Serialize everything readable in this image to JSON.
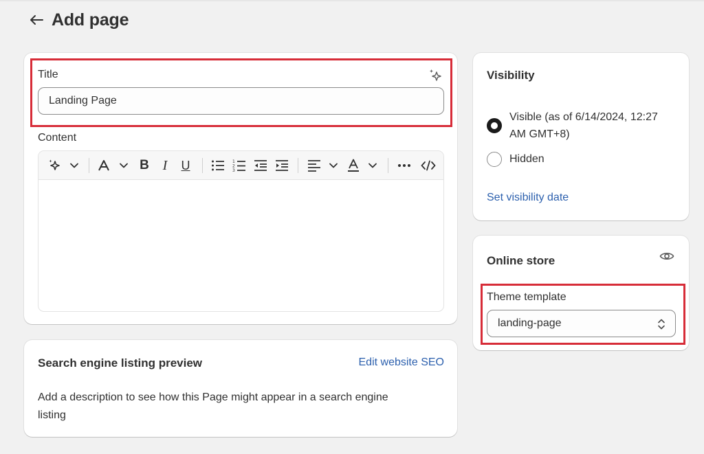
{
  "header": {
    "back_icon": "arrow-left-icon",
    "title": "Add page"
  },
  "main": {
    "title_label": "Title",
    "title_value": "Landing Page",
    "content_label": "Content",
    "ai_icon": "sparkle-icon",
    "toolbar_icons": [
      "sparkle-icon",
      "chevron-down-icon",
      "font-icon",
      "chevron-down-icon",
      "bold-icon",
      "italic-icon",
      "underline-icon",
      "bullet-list-icon",
      "numbered-list-icon",
      "outdent-icon",
      "indent-icon",
      "align-left-icon",
      "chevron-down-icon",
      "text-color-icon",
      "chevron-down-icon",
      "more-icon",
      "code-icon"
    ],
    "content_value": ""
  },
  "seo": {
    "heading": "Search engine listing preview",
    "edit_link": "Edit website SEO",
    "description_line1": "Add a description to see how this Page might appear in a search engine",
    "description_line2": "listing"
  },
  "visibility": {
    "heading": "Visibility",
    "option_visible_line1": "Visible (as of 6/14/2024, 12:27",
    "option_visible_line2": "AM GMT+8)",
    "option_hidden": "Hidden",
    "selected": "Visible",
    "set_date_link": "Set visibility date"
  },
  "online_store": {
    "heading": "Online store",
    "eye_icon": "eye-icon",
    "template_label": "Theme template",
    "template_value": "landing-page"
  },
  "colors": {
    "background": "#f1f1f1",
    "card": "#ffffff",
    "highlight": "#d72c38",
    "link": "#2b5fad",
    "text": "#303030"
  }
}
